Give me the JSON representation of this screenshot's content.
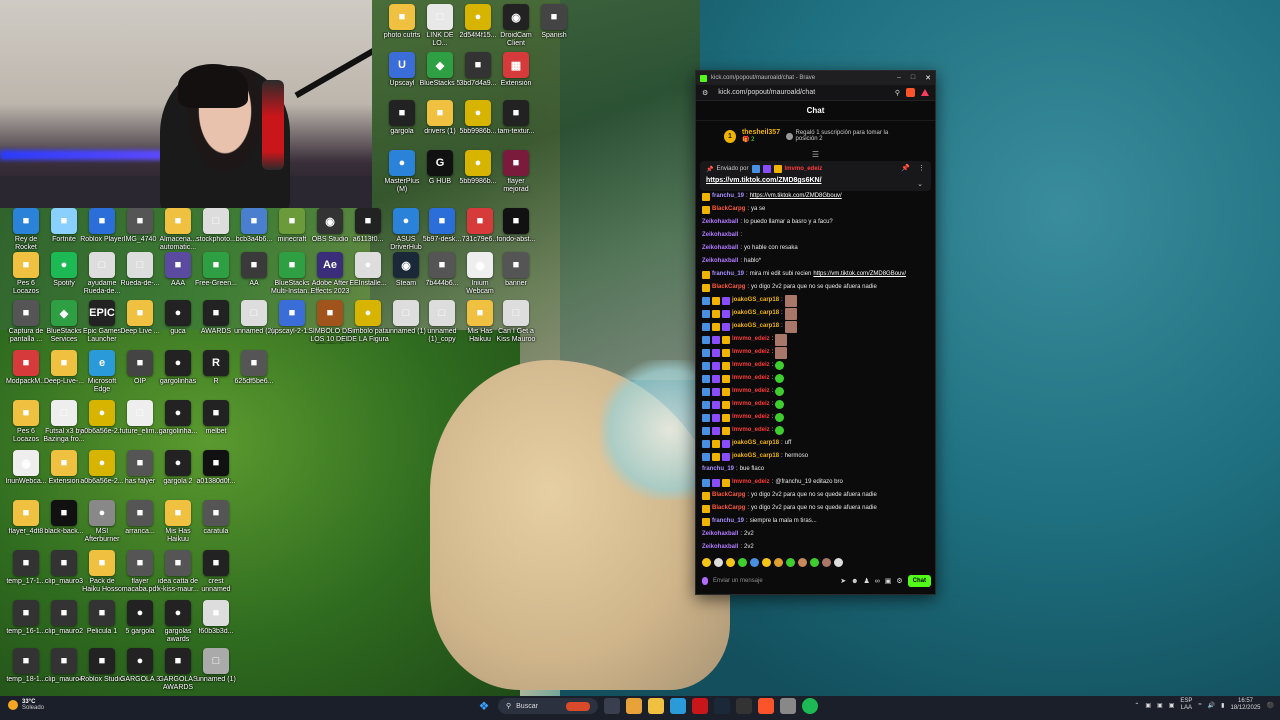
{
  "desktop": {
    "icons": [
      {
        "label": "photo cutrts",
        "color": "#f0c040",
        "glyph": "■"
      },
      {
        "label": "LINK DE LO...",
        "color": "#e8e8e8",
        "glyph": "□"
      },
      {
        "label": "2d54f4f15...",
        "color": "#d6b400",
        "glyph": "●"
      },
      {
        "label": "DroidCam Client",
        "color": "#222222",
        "glyph": "◉"
      },
      {
        "label": "Spanish",
        "color": "#444444",
        "glyph": "■"
      },
      {
        "label": "Upscayl",
        "color": "#3b6dd8",
        "glyph": "U"
      },
      {
        "label": "BlueStacks 5",
        "color": "#2ea043",
        "glyph": "◆"
      },
      {
        "label": "3bd7d4a9...",
        "color": "#333333",
        "glyph": "■"
      },
      {
        "label": "Extensión",
        "color": "#d63a3a",
        "glyph": "▦"
      },
      {
        "label": "gargola",
        "color": "#222222",
        "glyph": "■"
      },
      {
        "label": "drivers (1)",
        "color": "#f0c040",
        "glyph": "■"
      },
      {
        "label": "5bb9986b...",
        "color": "#d6b400",
        "glyph": "●"
      },
      {
        "label": "tam-textur...",
        "color": "#222222",
        "glyph": "■"
      },
      {
        "label": "MasterPlus (M)",
        "color": "#2b82d9",
        "glyph": "●"
      },
      {
        "label": "G HUB",
        "color": "#111111",
        "glyph": "G"
      },
      {
        "label": "5bb9986b...",
        "color": "#d6b400",
        "glyph": "●"
      },
      {
        "label": "flayer mejorad",
        "color": "#7a1b3b",
        "glyph": "■"
      },
      {
        "label": "Rey de Rocket Soccer",
        "color": "#2b82d9",
        "glyph": "■"
      },
      {
        "label": "Fortnite",
        "color": "#8ad0ff",
        "glyph": "■"
      },
      {
        "label": "Roblox Player",
        "color": "#2b6ed9",
        "glyph": "■"
      },
      {
        "label": "IMG_4740",
        "color": "#555555",
        "glyph": "■"
      },
      {
        "label": "Almacena... automatic...",
        "color": "#f0c040",
        "glyph": "■"
      },
      {
        "label": "stockphoto...",
        "color": "#dddddd",
        "glyph": "□"
      },
      {
        "label": "bcb3a4b6...",
        "color": "#4a7fd0",
        "glyph": "■"
      },
      {
        "label": "minecraft",
        "color": "#6b9a3a",
        "glyph": "■"
      },
      {
        "label": "OBS Studio",
        "color": "#333333",
        "glyph": "◉"
      },
      {
        "label": "a6113f0...",
        "color": "#222222",
        "glyph": "■"
      },
      {
        "label": "ASUS DriverHub",
        "color": "#2b82d9",
        "glyph": "●"
      },
      {
        "label": "5b97-desk...",
        "color": "#2b6ed9",
        "glyph": "■"
      },
      {
        "label": "731c79e6...",
        "color": "#d63a3a",
        "glyph": "■"
      },
      {
        "label": "fondo-abst...",
        "color": "#111111",
        "glyph": "■"
      },
      {
        "label": "Pes 6 Locazos",
        "color": "#f0c040",
        "glyph": "■"
      },
      {
        "label": "Spotify",
        "color": "#1db954",
        "glyph": "●"
      },
      {
        "label": "ayudame Rueda-de...",
        "color": "#dddddd",
        "glyph": "□"
      },
      {
        "label": "Rueda-de-...",
        "color": "#dddddd",
        "glyph": "□"
      },
      {
        "label": "AAA",
        "color": "#5a4aa0",
        "glyph": "■"
      },
      {
        "label": "Free-Green...",
        "color": "#2ea043",
        "glyph": "■"
      },
      {
        "label": "AA",
        "color": "#3a3a3a",
        "glyph": "■"
      },
      {
        "label": "BlueStacks Multi-Instan...",
        "color": "#2ea043",
        "glyph": "■"
      },
      {
        "label": "Adobe After Effects 2023",
        "color": "#3a2d7a",
        "glyph": "Ae"
      },
      {
        "label": "EEInstalle...",
        "color": "#dddddd",
        "glyph": "●"
      },
      {
        "label": "Steam",
        "color": "#1b2838",
        "glyph": "◉"
      },
      {
        "label": "7b444b6...",
        "color": "#555555",
        "glyph": "■"
      },
      {
        "label": "Inium Webcam",
        "color": "#eeeeee",
        "glyph": "◉"
      },
      {
        "label": "banner",
        "color": "#555555",
        "glyph": "■"
      },
      {
        "label": "Captura de pantalla ...",
        "color": "#555555",
        "glyph": "■"
      },
      {
        "label": "BlueStacks Services",
        "color": "#2ea043",
        "glyph": "◆"
      },
      {
        "label": "Epic Games Launcher",
        "color": "#222222",
        "glyph": "EPIC"
      },
      {
        "label": "Deep Live ...",
        "color": "#f0c040",
        "glyph": "■"
      },
      {
        "label": "guca",
        "color": "#222222",
        "glyph": "●"
      },
      {
        "label": "AWARDS",
        "color": "#222222",
        "glyph": "■"
      },
      {
        "label": "unnamed (2)",
        "color": "#dddddd",
        "glyph": "□"
      },
      {
        "label": "upscayl-2-1...",
        "color": "#3b6dd8",
        "glyph": "■"
      },
      {
        "label": "SIMBOLO DE LOS 10 DEL TEMPLO",
        "color": "#a0531b",
        "glyph": "■"
      },
      {
        "label": "Simbolo pata DE LA Figura",
        "color": "#d6b400",
        "glyph": "●"
      },
      {
        "label": "unnamed (1)",
        "color": "#dddddd",
        "glyph": "□"
      },
      {
        "label": "unnamed (1)_copy",
        "color": "#dddddd",
        "glyph": "□"
      },
      {
        "label": "Mis Has Haikuu",
        "color": "#f0c040",
        "glyph": "■"
      },
      {
        "label": "Can I Get a Kiss Mauroo",
        "color": "#dddddd",
        "glyph": "□"
      },
      {
        "label": "ModpackM...",
        "color": "#d63a3a",
        "glyph": "■"
      },
      {
        "label": "Deep-Live-...",
        "color": "#f0c040",
        "glyph": "■"
      },
      {
        "label": "Microsoft Edge",
        "color": "#2b9ad9",
        "glyph": "e"
      },
      {
        "label": "OIP",
        "color": "#444444",
        "glyph": "■"
      },
      {
        "label": "gargolinhas",
        "color": "#222222",
        "glyph": "●"
      },
      {
        "label": "R",
        "color": "#222222",
        "glyph": "R"
      },
      {
        "label": "625df5be6...",
        "color": "#555555",
        "glyph": "■"
      },
      {
        "label": "Pes 6 Locazos",
        "color": "#f0c040",
        "glyph": "■"
      },
      {
        "label": "Futsal x3 by Bazinga fro...",
        "color": "#eeeeee",
        "glyph": "□"
      },
      {
        "label": "a0b6a56e-2...",
        "color": "#d6b400",
        "glyph": "●"
      },
      {
        "label": "future_elim...",
        "color": "#eeeeee",
        "glyph": "□"
      },
      {
        "label": "gargolinha...",
        "color": "#222222",
        "glyph": "●"
      },
      {
        "label": "melbet",
        "color": "#222222",
        "glyph": "■"
      },
      {
        "label": "IriunWebca...",
        "color": "#eeeeee",
        "glyph": "◉"
      },
      {
        "label": "Extension",
        "color": "#f0c040",
        "glyph": "■"
      },
      {
        "label": "a0b6a56e-2...",
        "color": "#d6b400",
        "glyph": "●"
      },
      {
        "label": "has falyer",
        "color": "#555555",
        "glyph": "■"
      },
      {
        "label": "gargola 2",
        "color": "#222222",
        "glyph": "●"
      },
      {
        "label": "a01380d0f...",
        "color": "#111111",
        "glyph": "■"
      },
      {
        "label": "flayer_4dt8",
        "color": "#f0c040",
        "glyph": "■"
      },
      {
        "label": "black-back...",
        "color": "#111111",
        "glyph": "■"
      },
      {
        "label": "MSI Afterburner",
        "color": "#888888",
        "glyph": "●"
      },
      {
        "label": "arranca...",
        "color": "#555555",
        "glyph": "■"
      },
      {
        "label": "Mis Has Haikuu",
        "color": "#f0c040",
        "glyph": "■"
      },
      {
        "label": "caratula",
        "color": "#555555",
        "glyph": "■"
      },
      {
        "label": "temp_17-1...",
        "color": "#333333",
        "glyph": "■"
      },
      {
        "label": "clip_mauro3",
        "color": "#333333",
        "glyph": "■"
      },
      {
        "label": "Pack de Haiku Hosso",
        "color": "#f0c040",
        "glyph": "■"
      },
      {
        "label": "flayer macaba.pdf",
        "color": "#555555",
        "glyph": "■"
      },
      {
        "label": "idea catta de x-kiss-maur...",
        "color": "#555555",
        "glyph": "■"
      },
      {
        "label": "crest unnamed",
        "color": "#222222",
        "glyph": "■"
      },
      {
        "label": "temp_16-1...",
        "color": "#333333",
        "glyph": "■"
      },
      {
        "label": "clip_mauro2",
        "color": "#333333",
        "glyph": "■"
      },
      {
        "label": "Pelicula 1",
        "color": "#333333",
        "glyph": "■"
      },
      {
        "label": "5 gargola",
        "color": "#222222",
        "glyph": "●"
      },
      {
        "label": "gargolas awards",
        "color": "#222222",
        "glyph": "●"
      },
      {
        "label": "f60b3b3d...",
        "color": "#dddddd",
        "glyph": "■"
      },
      {
        "label": "temp_18-1...",
        "color": "#333333",
        "glyph": "■"
      },
      {
        "label": "clip_mauro4",
        "color": "#333333",
        "glyph": "■"
      },
      {
        "label": "Roblox Studio",
        "color": "#222222",
        "glyph": "■"
      },
      {
        "label": "GARGOLA 3",
        "color": "#222222",
        "glyph": "●"
      },
      {
        "label": "GARGOLAS AWARDS",
        "color": "#222222",
        "glyph": "■"
      },
      {
        "label": "unnamed (1)",
        "color": "#aaaaaa",
        "glyph": "□"
      }
    ]
  },
  "browser": {
    "title": "kick.com/popout/mauroald/chat - Brave",
    "url": "kick.com/popout/mauroald/chat",
    "chat_header": "Chat",
    "sub_banner": {
      "rank": "1",
      "user": "thesheil357",
      "count": "2",
      "text": "Regaló 1 suscripción para tomar la posición 2"
    },
    "pinned": {
      "label": "Enviado por",
      "user": "lmvmo_edeiz",
      "link": "https://vm.tiktok.com/ZMD8gs6KN/"
    },
    "messages": [
      {
        "user": "franchu_19",
        "ucolor": "#a890ff",
        "badges": [
          "gold"
        ],
        "text": "",
        "link": "https://vm.tiktok.com/ZMD8Gbouv/"
      },
      {
        "user": "BlackCarpg",
        "ucolor": "#ff5a3c",
        "badges": [
          "gold"
        ],
        "text": "ya se"
      },
      {
        "user": "Zeikohaxball",
        "ucolor": "#b27bff",
        "badges": [],
        "text": "lo puedo llamar a basro y a facu?"
      },
      {
        "user": "Zeikohaxball",
        "ucolor": "#b27bff",
        "badges": [],
        "text": ""
      },
      {
        "user": "Zeikohaxball",
        "ucolor": "#b27bff",
        "badges": [],
        "text": "yo hable con resaka"
      },
      {
        "user": "Zeikohaxball",
        "ucolor": "#b27bff",
        "badges": [],
        "text": "hablo*"
      },
      {
        "user": "franchu_19",
        "ucolor": "#a890ff",
        "badges": [
          "gold"
        ],
        "text": "mira mi edit  subi recien",
        "link": "https://vm.tiktok.com/ZMD8GBouv/"
      },
      {
        "user": "BlackCarpg",
        "ucolor": "#ff5a3c",
        "badges": [
          "gold"
        ],
        "text": "yo digo 2v2 para que no se quede afuera nadie"
      },
      {
        "user": "joakoGS_carp18",
        "ucolor": "#f0b400",
        "badges": [
          "blue",
          "gold",
          "purple"
        ],
        "text": "",
        "emote": "img"
      },
      {
        "user": "joakoGS_carp18",
        "ucolor": "#f0b400",
        "badges": [
          "blue",
          "gold",
          "purple"
        ],
        "text": "",
        "emote": "img"
      },
      {
        "user": "joakoGS_carp18",
        "ucolor": "#f0b400",
        "badges": [
          "blue",
          "gold",
          "purple"
        ],
        "text": "",
        "emote": "img"
      },
      {
        "user": "lmvmo_edeiz",
        "ucolor": "#ff3b3b",
        "badges": [
          "blue",
          "purple",
          "gold"
        ],
        "text": "",
        "emote": "img"
      },
      {
        "user": "lmvmo_edeiz",
        "ucolor": "#ff3b3b",
        "badges": [
          "blue",
          "purple",
          "gold"
        ],
        "text": "",
        "emote": "img"
      },
      {
        "user": "lmvmo_edeiz",
        "ucolor": "#ff3b3b",
        "badges": [
          "blue",
          "purple",
          "gold"
        ],
        "text": "",
        "emote": "green"
      },
      {
        "user": "lmvmo_edeiz",
        "ucolor": "#ff3b3b",
        "badges": [
          "blue",
          "purple",
          "gold"
        ],
        "text": "",
        "emote": "green"
      },
      {
        "user": "lmvmo_edeiz",
        "ucolor": "#ff3b3b",
        "badges": [
          "blue",
          "purple",
          "gold"
        ],
        "text": "",
        "emote": "green"
      },
      {
        "user": "lmvmo_edeiz",
        "ucolor": "#ff3b3b",
        "badges": [
          "blue",
          "purple",
          "gold"
        ],
        "text": "",
        "emote": "green"
      },
      {
        "user": "lmvmo_edeiz",
        "ucolor": "#ff3b3b",
        "badges": [
          "blue",
          "purple",
          "gold"
        ],
        "text": "",
        "emote": "green"
      },
      {
        "user": "lmvmo_edeiz",
        "ucolor": "#ff3b3b",
        "badges": [
          "blue",
          "purple",
          "gold"
        ],
        "text": "",
        "emote": "green"
      },
      {
        "user": "joakoGS_carp18",
        "ucolor": "#f0b400",
        "badges": [
          "blue",
          "gold",
          "purple"
        ],
        "text": "uff"
      },
      {
        "user": "joakoGS_carp18",
        "ucolor": "#f0b400",
        "badges": [
          "blue",
          "gold",
          "purple"
        ],
        "text": "hermoso"
      },
      {
        "user": "franchu_19",
        "ucolor": "#a890ff",
        "badges": [],
        "text": "bue flaco"
      },
      {
        "user": "lmvmo_edeiz",
        "ucolor": "#ff3b3b",
        "badges": [
          "blue",
          "purple",
          "gold"
        ],
        "text": "@franchu_19 editazo bro"
      },
      {
        "user": "BlackCarpg",
        "ucolor": "#ff5a3c",
        "badges": [
          "gold"
        ],
        "text": "yo digo 2v2 para que no se quede afuera nadie"
      },
      {
        "user": "BlackCarpg",
        "ucolor": "#ff5a3c",
        "badges": [
          "gold"
        ],
        "text": "yo digo 2v2 para que no se quede afuera nadie"
      },
      {
        "user": "franchu_19",
        "ucolor": "#a890ff",
        "badges": [
          "gold"
        ],
        "text": "siempre la mala m tiras..."
      },
      {
        "user": "Zeikohaxball",
        "ucolor": "#b27bff",
        "badges": [],
        "text": "2v2"
      },
      {
        "user": "Zeikohaxball",
        "ucolor": "#b27bff",
        "badges": [],
        "text": "2v2"
      }
    ],
    "input_placeholder": "Enviar un mensaje",
    "send_label": "Chat"
  },
  "taskbar": {
    "weather_temp": "33°C",
    "weather_desc": "Soleado",
    "search_label": "Buscar",
    "lang_line1": "ESP",
    "lang_line2": "LAA",
    "time": "16:57",
    "date": "18/12/2025"
  }
}
